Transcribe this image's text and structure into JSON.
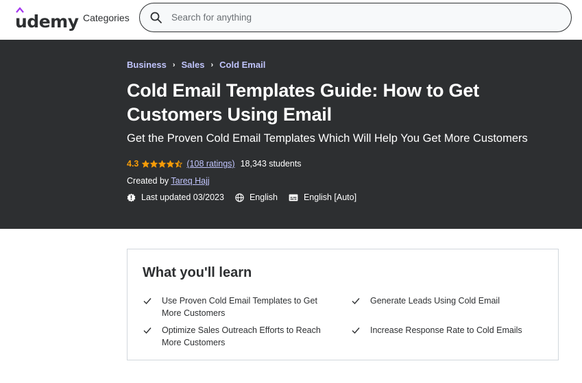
{
  "header": {
    "logo_text": "udemy",
    "categories_label": "Categories",
    "search_placeholder": "Search for anything"
  },
  "breadcrumb": [
    "Business",
    "Sales",
    "Cold Email"
  ],
  "course": {
    "title": "Cold Email Templates Guide: How to Get Customers Using Email",
    "subtitle": "Get the Proven Cold Email Templates Which Will Help You Get More Customers",
    "rating": "4.3",
    "rating_value": 4.3,
    "ratings_text": "(108 ratings)",
    "students_text": "18,343 students",
    "created_by_label": "Created by",
    "author": "Tareq Hajj",
    "last_updated": "Last updated 03/2023",
    "language": "English",
    "captions": "English [Auto]"
  },
  "learn": {
    "title": "What you'll learn",
    "items": [
      "Use Proven Cold Email Templates to Get More Customers",
      "Generate Leads Using Cold Email",
      "Optimize Sales Outreach Efforts to Reach More Customers",
      "Increase Response Rate to Cold Emails"
    ]
  },
  "colors": {
    "hero_bg": "#2d2f31",
    "link_purple": "#c0c4fc",
    "star_orange": "#f69c08",
    "brand_purple": "#a435f0"
  }
}
